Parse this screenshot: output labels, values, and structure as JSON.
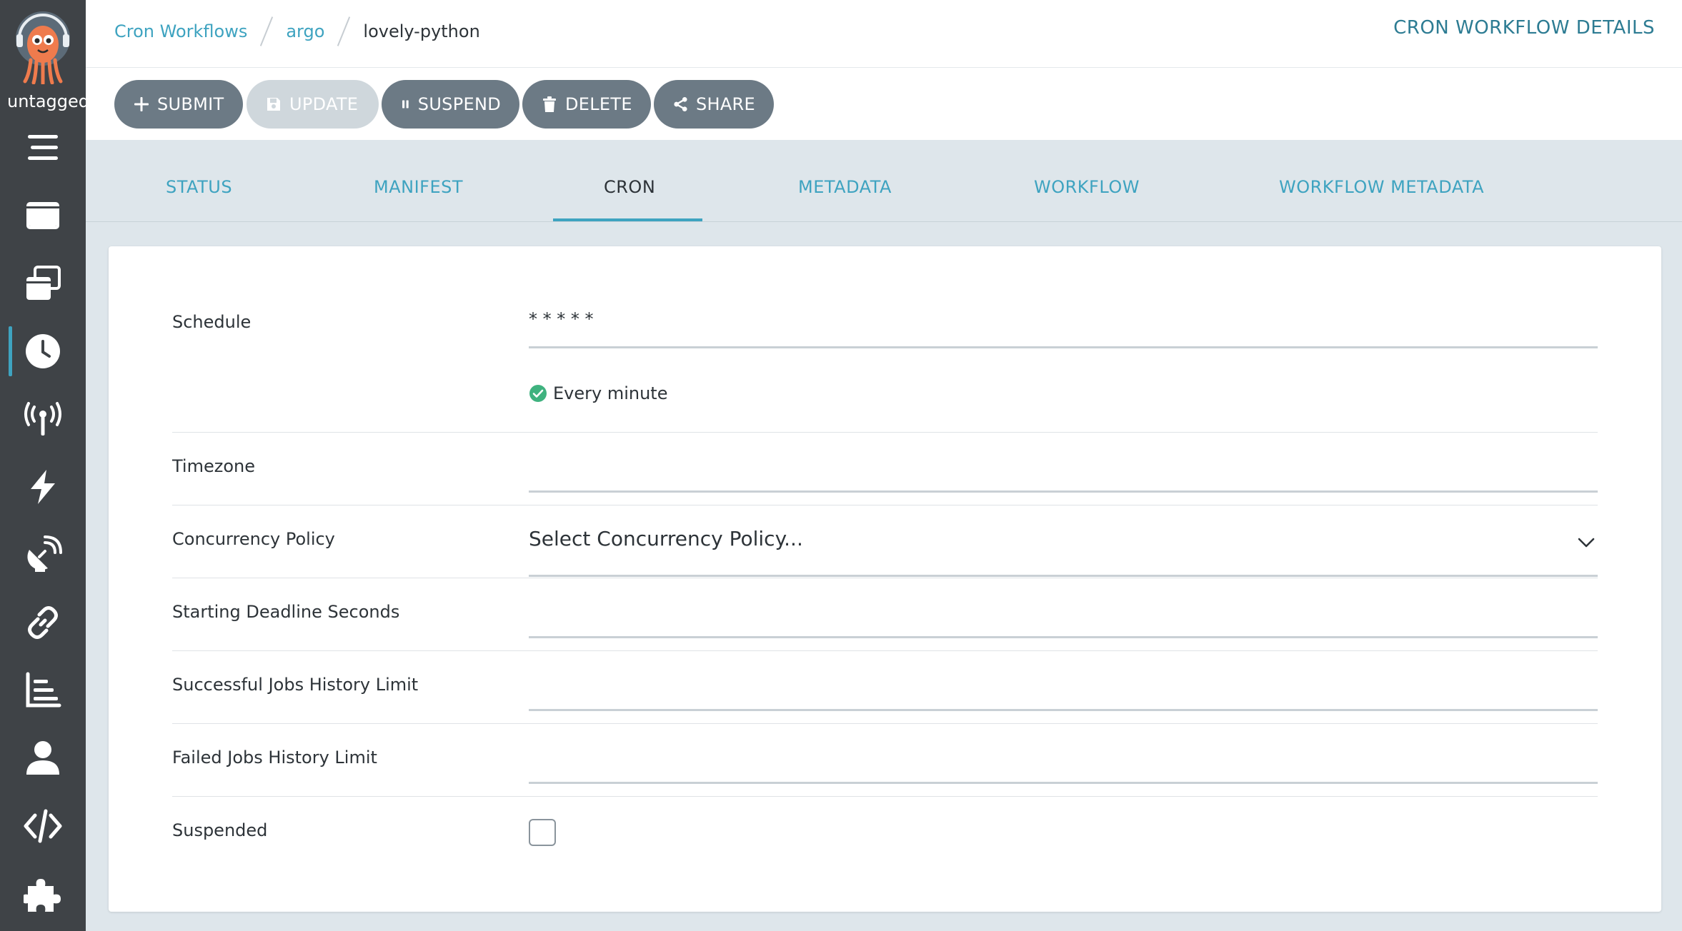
{
  "sidebar": {
    "user_label": "untagged",
    "nav_icons": [
      "menu-icon",
      "window-icon",
      "stack-icon",
      "clock-icon",
      "antenna-icon",
      "bolt-icon",
      "satellite-icon",
      "link-icon",
      "chart-icon",
      "user-icon",
      "code-icon",
      "puzzle-icon"
    ],
    "active": "clock-icon"
  },
  "breadcrumb": {
    "items": [
      "Cron Workflows",
      "argo"
    ],
    "current": "lovely-python"
  },
  "header": {
    "title": "CRON WORKFLOW DETAILS"
  },
  "toolbar": {
    "submit_label": "SUBMIT",
    "update_label": "UPDATE",
    "suspend_label": "SUSPEND",
    "delete_label": "DELETE",
    "share_label": "SHARE"
  },
  "tabs": [
    "STATUS",
    "MANIFEST",
    "CRON",
    "METADATA",
    "WORKFLOW",
    "WORKFLOW METADATA"
  ],
  "active_tab": "CRON",
  "form": {
    "schedule_label": "Schedule",
    "schedule_value": "* * * * *",
    "schedule_hint": "Every minute",
    "timezone_label": "Timezone",
    "timezone_value": "",
    "concurrency_label": "Concurrency Policy",
    "concurrency_value": "Select Concurrency Policy...",
    "starting_deadline_label": "Starting Deadline Seconds",
    "starting_deadline_value": "",
    "successful_history_label": "Successful Jobs History Limit",
    "successful_history_value": "",
    "failed_history_label": "Failed Jobs History Limit",
    "failed_history_value": "",
    "suspended_label": "Suspended",
    "suspended_checked": false
  },
  "colors": {
    "accent": "#3ea3c0",
    "sidebar": "#3f4347",
    "button": "#6c7a85",
    "button_disabled": "#cfd7dc",
    "success": "#3fb27f"
  }
}
